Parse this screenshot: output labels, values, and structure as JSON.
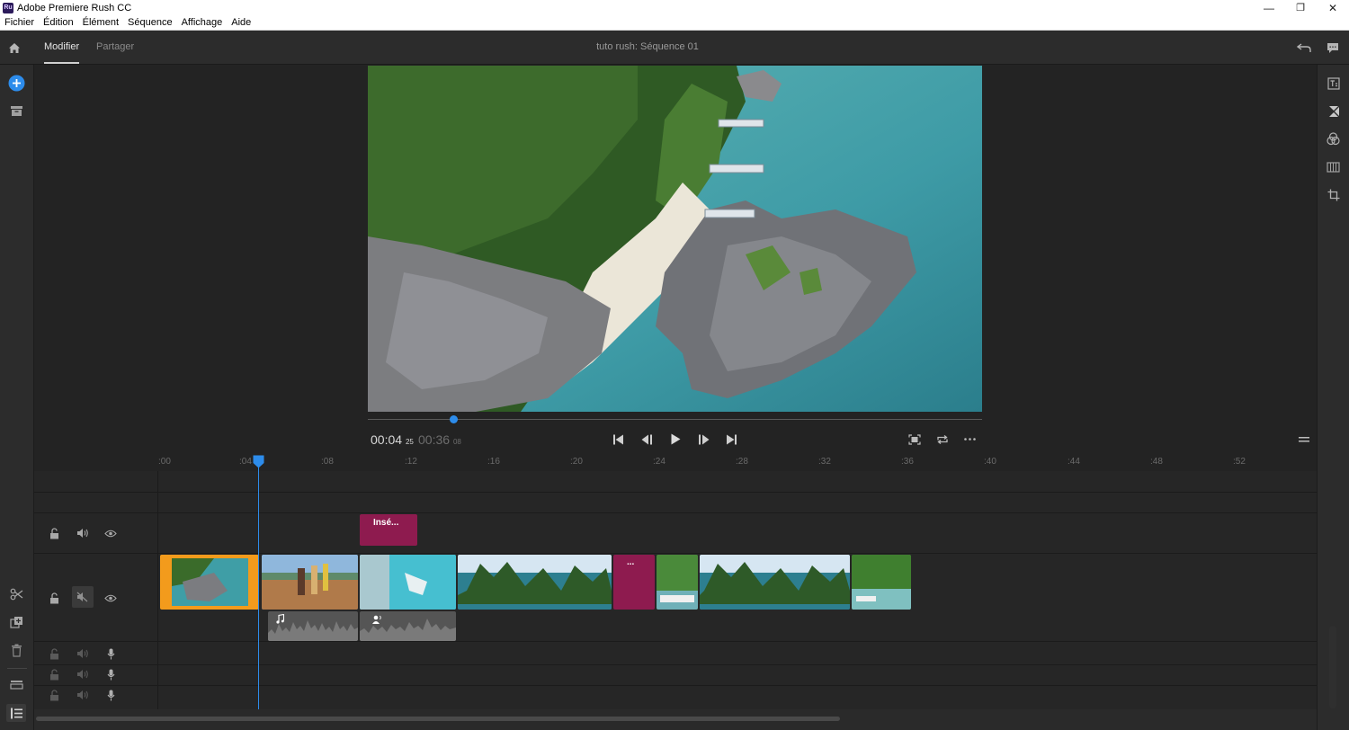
{
  "window": {
    "title": "Adobe Premiere Rush CC",
    "app_icon": "Ru",
    "controls": {
      "minimize": "—",
      "restore": "❐",
      "close": "✕"
    }
  },
  "menu": [
    "Fichier",
    "Édition",
    "Élément",
    "Séquence",
    "Affichage",
    "Aide"
  ],
  "header": {
    "tabs": [
      {
        "label": "Modifier",
        "active": true
      },
      {
        "label": "Partager",
        "active": false
      }
    ],
    "sequence_title": "tuto rush: Séquence  01"
  },
  "player": {
    "current_time": "00:04",
    "current_frames": "25",
    "duration_time": "00:36",
    "duration_frames": "08",
    "playhead_fraction": 0.14
  },
  "ruler": {
    "ticks": [
      ":00",
      ":04",
      ":08",
      ":12",
      ":16",
      ":20",
      ":24",
      ":28",
      ":32",
      ":36",
      ":40",
      ":44",
      ":48",
      ":52"
    ]
  },
  "timeline": {
    "title_clip": {
      "label": "Insé..."
    },
    "transition_clip": {
      "label": "..."
    }
  },
  "colors": {
    "accent": "#2d8ceb",
    "selected_clip": "#f39b1c",
    "title_clip": "#8e1b4f",
    "background": "#232323"
  }
}
